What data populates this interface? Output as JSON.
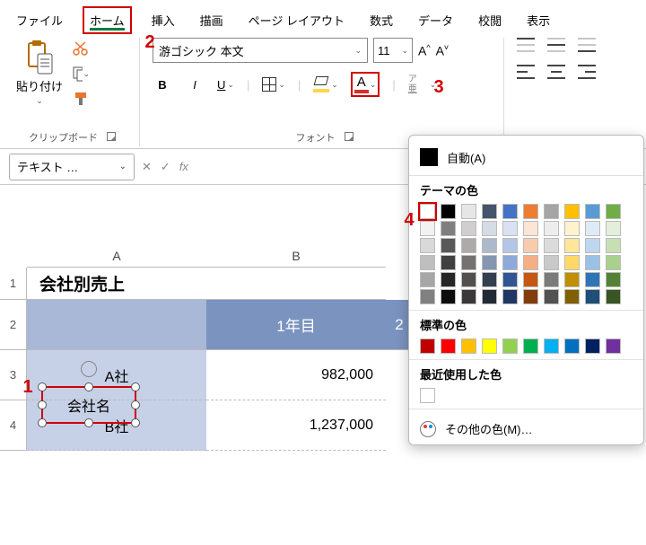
{
  "tabs": {
    "file": "ファイル",
    "home": "ホーム",
    "insert": "挿入",
    "draw": "描画",
    "layout": "ページ レイアウト",
    "formulas": "数式",
    "data": "データ",
    "review": "校閲",
    "view": "表示"
  },
  "ribbon": {
    "clipboard": {
      "paste": "貼り付け",
      "group_label": "クリップボード"
    },
    "font": {
      "font_name": "游ゴシック 本文",
      "font_size": "11",
      "grow": "A^",
      "shrink": "A˅",
      "bold": "B",
      "italic": "I",
      "underline": "U",
      "font_a": "A",
      "ruby_top": "ア",
      "ruby_bottom": "亜",
      "group_label": "フォント"
    }
  },
  "fx": {
    "namebox": "テキスト …",
    "caret": "⌄",
    "cancel": "✕",
    "confirm": "✓",
    "fx": "fx"
  },
  "sheet": {
    "col_a": "A",
    "col_b": "B",
    "r1": "1",
    "r2": "2",
    "r3": "3",
    "r4": "4",
    "title": "会社別売上",
    "head_year1": "1年目",
    "head_year2_partial": "2",
    "a3": "A社",
    "b3": "982,000",
    "a4": "B社",
    "b4": "1,237,000",
    "textbox_label": "会社名"
  },
  "color_panel": {
    "auto": "自動(A)",
    "theme": "テーマの色",
    "standard": "標準の色",
    "recent": "最近使用した色",
    "more": "その他の色(M)…",
    "theme_row": [
      "#ffffff",
      "#000000",
      "#e7e6e6",
      "#44546a",
      "#4472c4",
      "#ed7d31",
      "#a5a5a5",
      "#ffc000",
      "#5b9bd5",
      "#70ad47"
    ],
    "theme_shades": [
      [
        "#f2f2f2",
        "#7f7f7f",
        "#d0cece",
        "#d6dce5",
        "#d9e1f2",
        "#fce4d6",
        "#ededed",
        "#fff2cc",
        "#ddebf7",
        "#e2efda"
      ],
      [
        "#d9d9d9",
        "#595959",
        "#aeaaaa",
        "#acb9ca",
        "#b4c6e7",
        "#f8cbad",
        "#dbdbdb",
        "#ffe699",
        "#bdd7ee",
        "#c6e0b4"
      ],
      [
        "#bfbfbf",
        "#404040",
        "#757171",
        "#8497b0",
        "#8ea9db",
        "#f4b084",
        "#c9c9c9",
        "#ffd966",
        "#9bc2e6",
        "#a9d08e"
      ],
      [
        "#a6a6a6",
        "#262626",
        "#524f4f",
        "#333f4f",
        "#305496",
        "#c65911",
        "#7b7b7b",
        "#bf8f00",
        "#2f75b5",
        "#548235"
      ],
      [
        "#808080",
        "#0d0d0d",
        "#3a3838",
        "#222b35",
        "#203764",
        "#833c0c",
        "#525252",
        "#806000",
        "#1f4e78",
        "#375623"
      ]
    ],
    "standard_row": [
      "#c00000",
      "#ff0000",
      "#ffc000",
      "#ffff00",
      "#92d050",
      "#00b050",
      "#00b0f0",
      "#0070c0",
      "#002060",
      "#7030a0"
    ],
    "recent_row": [
      "#ffffff"
    ]
  },
  "badges": {
    "b1": "1",
    "b2": "2",
    "b3": "3",
    "b4": "4"
  }
}
